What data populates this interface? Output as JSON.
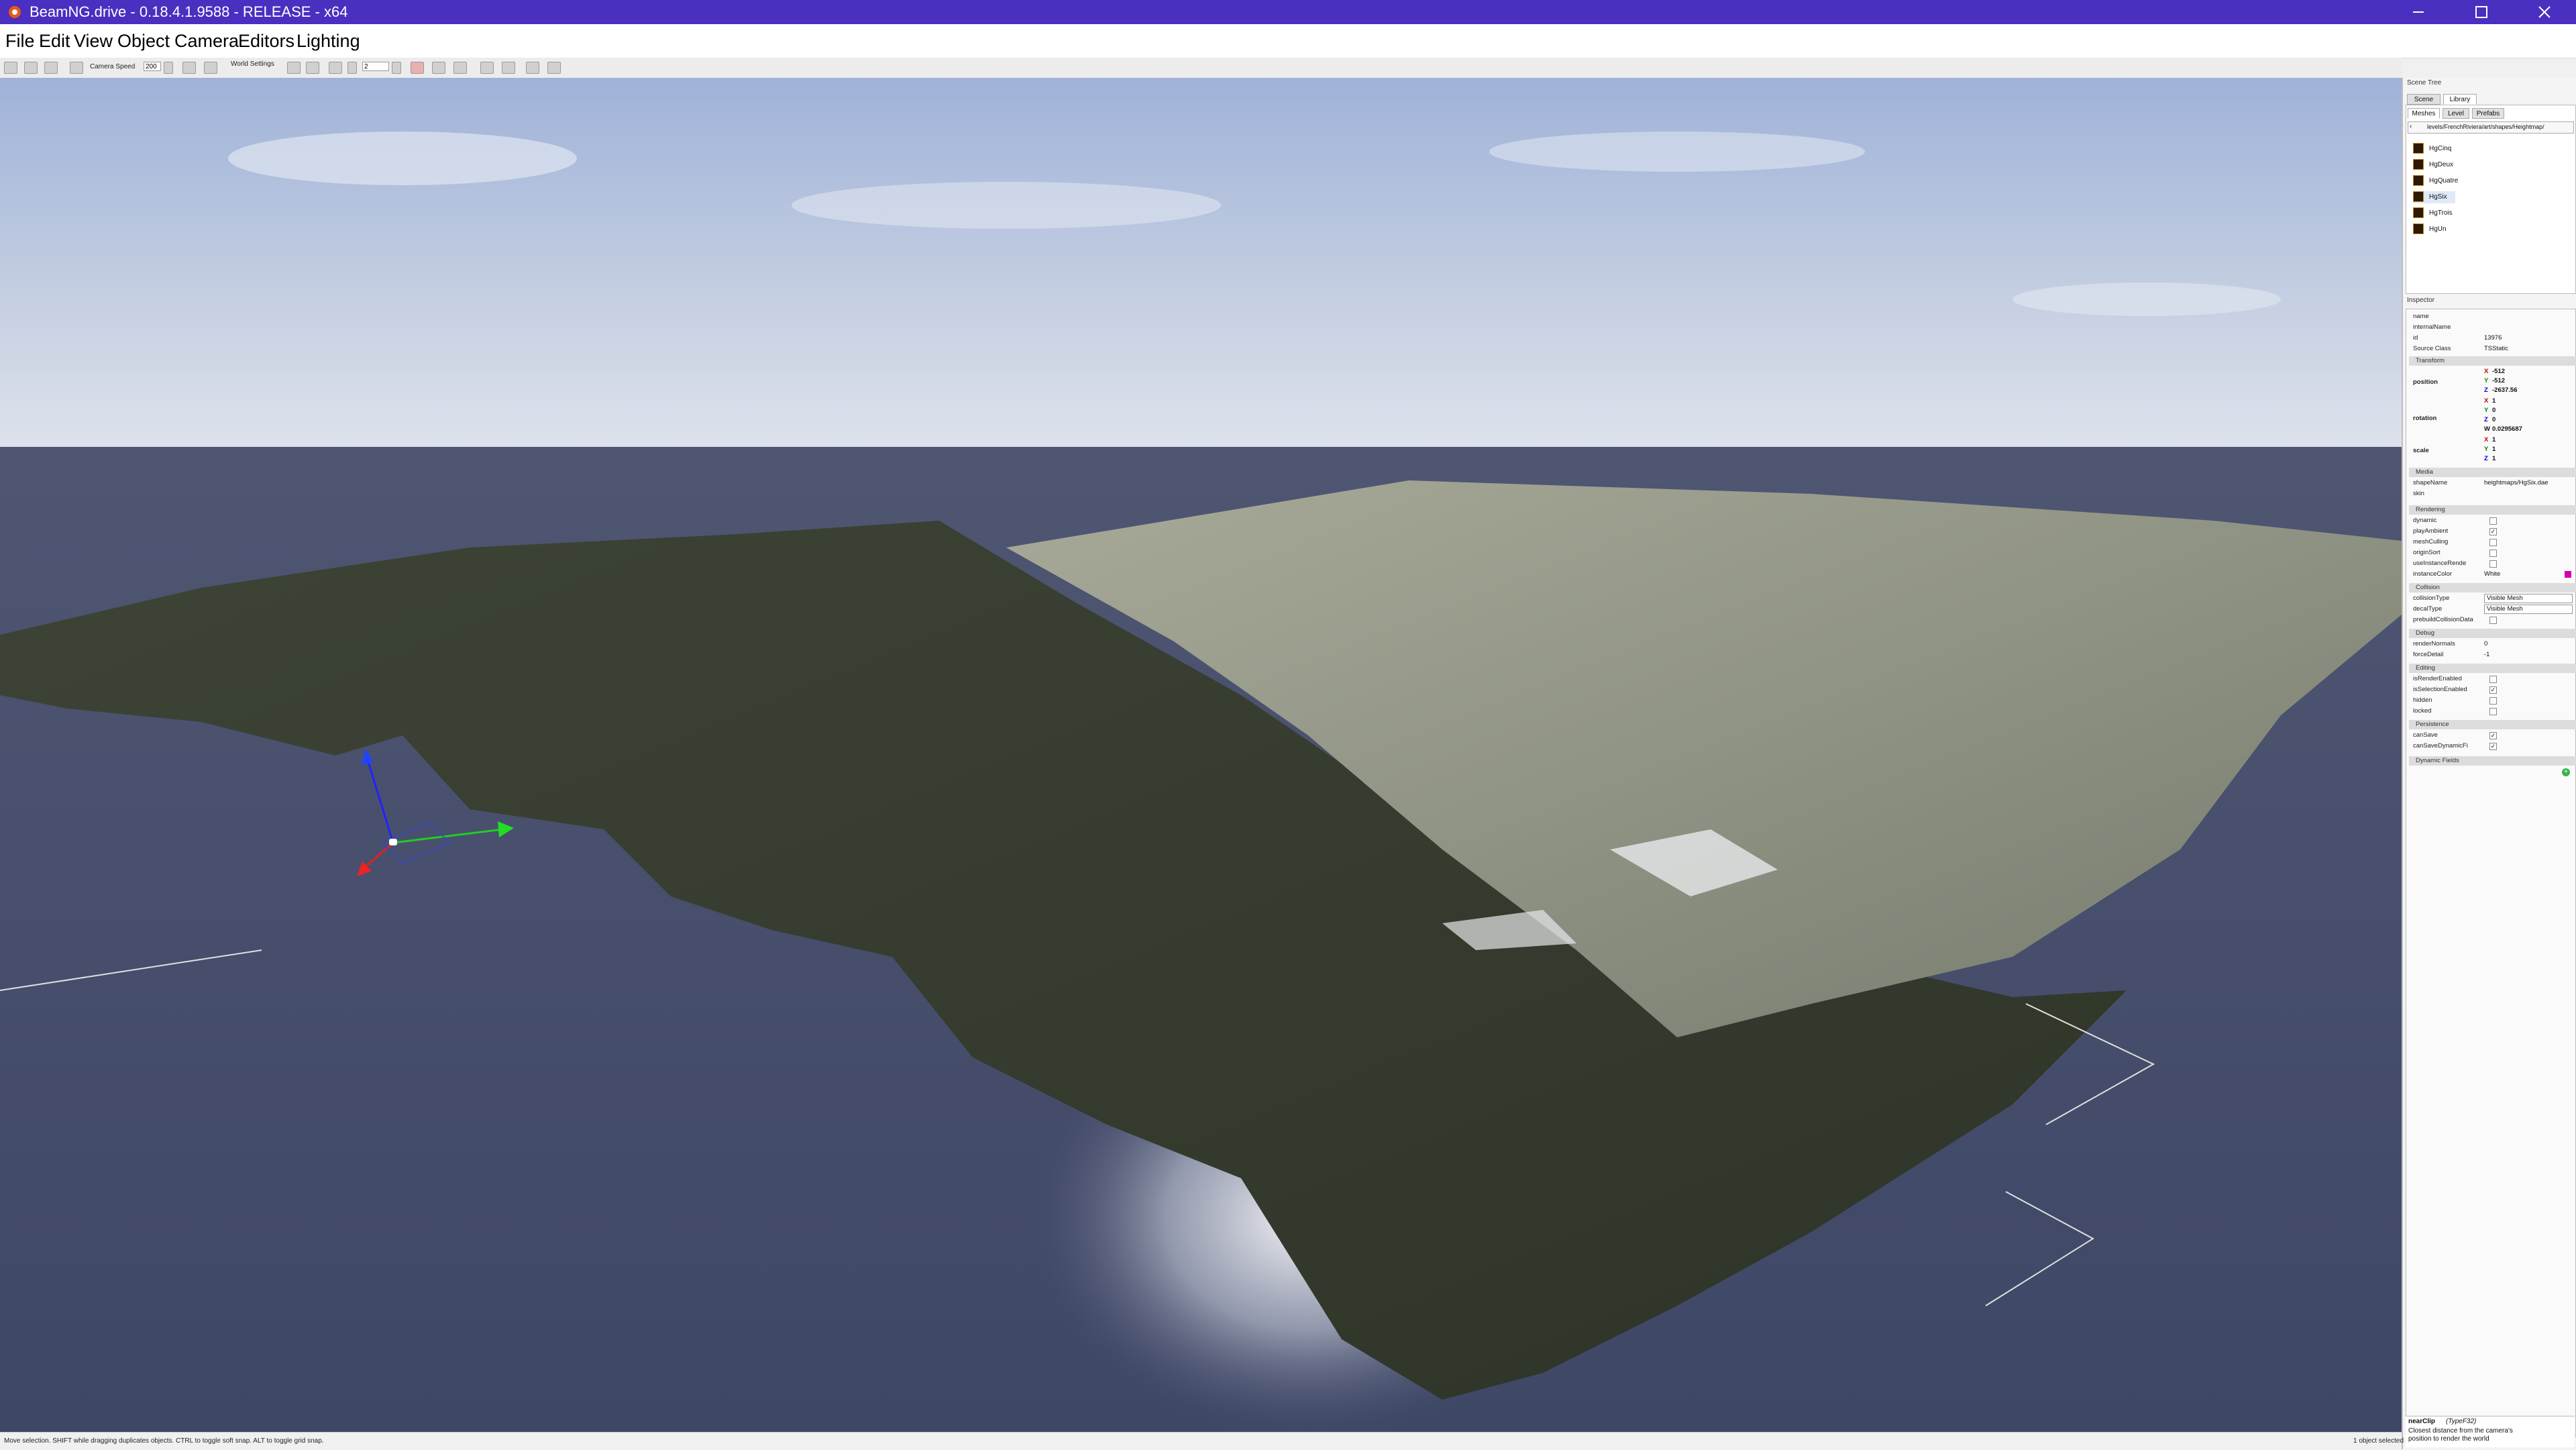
{
  "window": {
    "title": "BeamNG.drive - 0.18.4.1.9588 - RELEASE - x64",
    "accent_color": "#4a2fc0"
  },
  "menu": [
    "File",
    "Edit",
    "View",
    "Object",
    "Camera",
    "Editors",
    "Lighting"
  ],
  "toolbar": {
    "camera_speed_label": "Camera Speed",
    "camera_speed_value": "200",
    "world_settings_label": "World Settings",
    "snap_value": "2"
  },
  "scene_tree": {
    "header": "Scene Tree",
    "tabs": [
      "Scene",
      "Library"
    ],
    "active_tab": "Library",
    "subtabs": [
      "Meshes",
      "Level",
      "Prefabs"
    ],
    "path": "levels/FrenchRiviera/art/shapes/Heightmap/",
    "items": [
      "HgCinq",
      "HgDeux",
      "HgQuatre",
      "HgSix",
      "HgTrois",
      "HgUn"
    ],
    "selected_item": "HgSix"
  },
  "inspector": {
    "header": "Inspector",
    "rows": {
      "name": "",
      "internal_name": "",
      "id": "13976",
      "source_class": "TSStatic"
    },
    "labels": {
      "name": "name",
      "internal_name": "internalName",
      "id": "id",
      "source_class": "Source Class",
      "position": "position",
      "rotation": "rotation",
      "scale": "scale",
      "shape_name": "shapeName",
      "skin": "skin",
      "dynamic": "dynamic",
      "plays_ambient": "playAmbient",
      "mesh_culling": "meshCulling",
      "origin_sort": "originSort",
      "use_instance_render": "useInstanceRende",
      "instance_color": "instanceColor",
      "collision_type": "collisionType",
      "decal_type": "decalType",
      "prebuild_collision": "prebuildCollisionData",
      "render_normals": "renderNormals",
      "force_detail": "forceDetail",
      "is_render_enabled": "isRenderEnabled",
      "is_selection_enabled": "isSelectionEnabled",
      "hidden": "hidden",
      "locked": "locked",
      "can_save": "canSave",
      "can_save_dynamic": "canSaveDynamicFi"
    },
    "sections": {
      "transform": "Transform",
      "media": "Media",
      "rendering": "Rendering",
      "collision": "Collision",
      "debug": "Debug",
      "editing": "Editing",
      "persistence": "Persistence",
      "dynamic_fields": "Dynamic Fields"
    },
    "position": {
      "x": "-512",
      "y": "-512",
      "z": "-2637.56"
    },
    "rotation": {
      "x": "1",
      "y": "0",
      "z": "0",
      "w": "0.0295687"
    },
    "scale": {
      "x": "1",
      "y": "1",
      "z": "1"
    },
    "shape_name_value": "heightmaps/HgSix.dae",
    "instance_color_value": "White",
    "collision_type_value": "Visible Mesh",
    "decal_type_value": "Visible Mesh",
    "render_normals_value": "0",
    "force_detail_value": "-1",
    "help_title": "nearClip",
    "help_type": "(TypeF32)",
    "help_text_1": "Closest distance from the camera's",
    "help_text_2": "position to render the world"
  },
  "status": {
    "left": "Move selection.  SHIFT while dragging duplicates objects.  CTRL to toggle soft snap.  ALT to toggle grid snap.",
    "right": "1 object selected"
  },
  "icons": {
    "app": "beamng-logo-icon",
    "minimize": "minimize-icon",
    "maximize": "maximize-icon",
    "close": "close-icon",
    "gizmo": "translate-gizmo-icon"
  }
}
